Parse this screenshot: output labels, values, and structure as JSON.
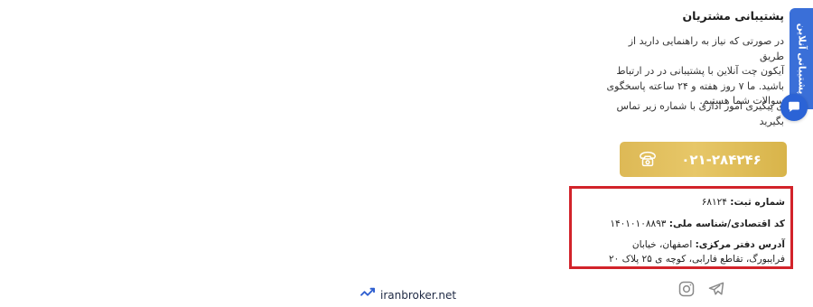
{
  "support": {
    "heading": "پشتیبانی مشتریان",
    "para1_lines": [
      "در صورتی که نیاز به راهنمایی دارید از طریق",
      "آیکون چت آنلاین با پشتیبانی در در ارتباط",
      "باشید. ما ۷ روز هفته و ۲۴ ساعته پاسخگوی",
      "سوالات شما هستیم."
    ],
    "para2_lines": [
      "ی پیگیری امور اداری با شماره زیر تماس",
      "بگیرید"
    ],
    "phone_number": "۰۲۱-۲۸۴۲۴۶"
  },
  "info": {
    "reg_label": "شماره ثبت:",
    "reg_value": "۶۸۱۲۴",
    "eco_label": "کد اقتصادی/شناسه ملی:",
    "eco_value": "۱۴۰۱۰۱۰۸۸۹۳",
    "address_label": "آدرس دفتر مرکزی:",
    "address_line1": "اصفهان، خیابان",
    "address_line2": "فرایبورگ، تقاطع فارابی، کوچه ی ۲۵ پلاک ۲۰"
  },
  "brand": {
    "name": "iranbroker.net"
  },
  "online_support": {
    "label": "پشتیبانی آنلاین"
  },
  "icons": {
    "phone": "phone-icon",
    "instagram": "instagram-icon",
    "telegram": "telegram-icon",
    "chat": "chat-icon",
    "brand": "chart-check-icon"
  },
  "colors": {
    "gold": "#e0bd5c",
    "highlight_border": "#d2232a",
    "online_tab": "#3a6fd8",
    "chat_bubble": "#2b63d6"
  }
}
